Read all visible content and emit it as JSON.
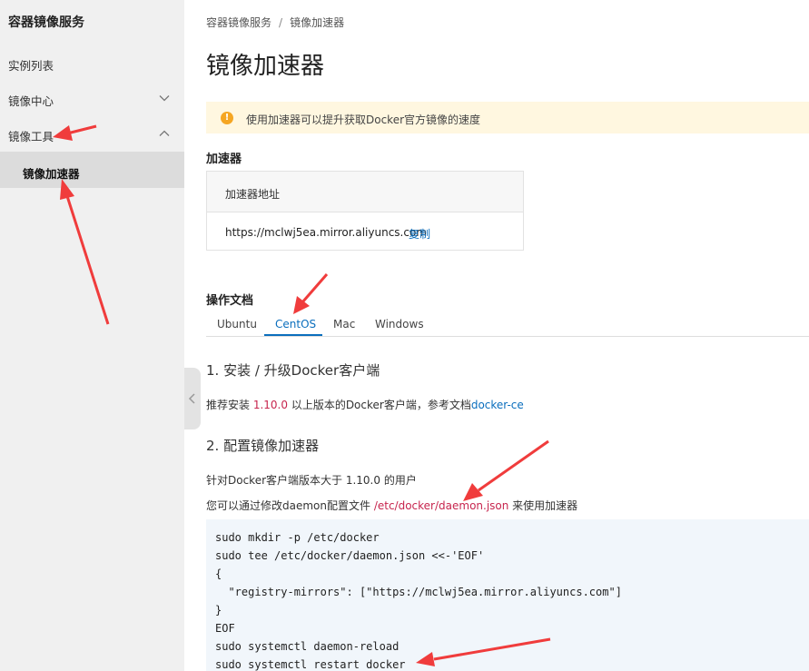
{
  "sidebar": {
    "title": "容器镜像服务",
    "items": [
      {
        "label": "实例列表"
      },
      {
        "label": "镜像中心"
      },
      {
        "label": "镜像工具"
      }
    ],
    "sub_item": {
      "label": "镜像加速器"
    }
  },
  "breadcrumb": {
    "root": "容器镜像服务",
    "separator": "/",
    "current": "镜像加速器"
  },
  "page_title": "镜像加速器",
  "notice": {
    "icon": "!",
    "text": "使用加速器可以提升获取Docker官方镜像的速度"
  },
  "accelerator": {
    "heading": "加速器",
    "table_header": "加速器地址",
    "url": "https://mclwj5ea.mirror.aliyuncs.com",
    "copy_label": "复制"
  },
  "docs": {
    "heading": "操作文档",
    "tabs": [
      {
        "label": "Ubuntu"
      },
      {
        "label": "CentOS"
      },
      {
        "label": "Mac"
      },
      {
        "label": "Windows"
      }
    ],
    "active_tab": "CentOS"
  },
  "step1": {
    "title": "1. 安装 / 升级Docker客户端",
    "p_prefix": "推荐安装 ",
    "version": "1.10.0",
    "p_middle": " 以上版本的Docker客户端，参考文档",
    "link": "docker-ce"
  },
  "step2": {
    "title": "2. 配置镜像加速器",
    "line1": "针对Docker客户端版本大于 1.10.0 的用户",
    "line2_prefix": "您可以通过修改daemon配置文件 ",
    "path": "/etc/docker/daemon.json",
    "line2_suffix": " 来使用加速器"
  },
  "code_lines": [
    "sudo mkdir -p /etc/docker",
    "sudo tee /etc/docker/daemon.json <<-'EOF'",
    "{",
    "  \"registry-mirrors\": [\"https://mclwj5ea.mirror.aliyuncs.com\"]",
    "}",
    "EOF",
    "sudo systemctl daemon-reload",
    "sudo systemctl restart docker"
  ],
  "colors": {
    "accent": "#0a6ebd",
    "annotation_arrow": "#f03c3c",
    "notice_bg": "#fff7e0",
    "warning_icon": "#f5a623"
  }
}
